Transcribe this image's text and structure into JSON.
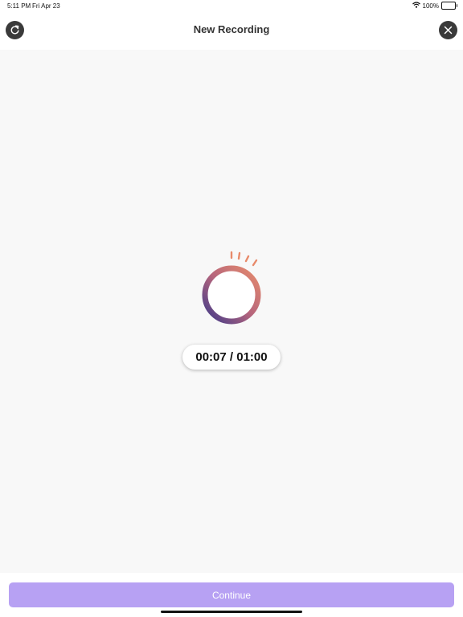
{
  "status_bar": {
    "time": "5:11 PM",
    "date": "Fri Apr 23",
    "battery_text": "100%",
    "wifi_icon": "wifi-icon",
    "battery_icon": "battery-full-icon"
  },
  "nav": {
    "title": "New Recording",
    "left_button_icon": "refresh-icon",
    "right_button_icon": "close-icon"
  },
  "recorder": {
    "icon": "sound-wave-icon",
    "timer": "00:07 / 01:00"
  },
  "footer": {
    "continue_label": "Continue"
  },
  "colors": {
    "accent_ring_start": "#e48a6c",
    "accent_ring_end": "#4a3a86",
    "continue_button": "#b7a1f3",
    "nav_button": "#3a3a3a"
  }
}
